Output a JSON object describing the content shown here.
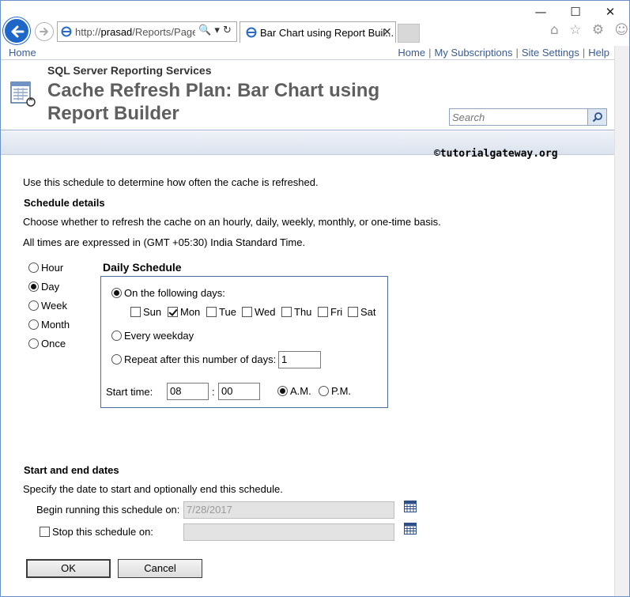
{
  "window": {
    "minimize": "—",
    "maximize": "☐",
    "close": "✕"
  },
  "browser": {
    "address_prefix": "http://",
    "address_host": "prasad",
    "address_path": "/Reports/Page:",
    "address_icons": "🔍 ▾ ↻",
    "tab_title": "Bar Chart using Report Buil...",
    "tab_close": "✕",
    "toolbar_icons": "⌂ ☆ ⚙ ☺"
  },
  "header": {
    "home_left": "Home",
    "links": [
      "Home",
      "My Subscriptions",
      "Site Settings",
      "Help"
    ],
    "ssrs_label": "SQL Server Reporting Services",
    "title": "Cache Refresh Plan: Bar Chart using Report Builder",
    "search_placeholder": "Search",
    "watermark": "©tutorialgateway.org"
  },
  "content": {
    "intro": "Use this schedule to determine how often the cache is refreshed.",
    "schedule_details_heading": "Schedule details",
    "choose_text": "Choose whether to refresh the cache on an hourly, daily, weekly, monthly, or one-time basis.",
    "timezone_text": "All times are expressed in (GMT +05:30) India Standard Time.",
    "frequency_options": [
      {
        "label": "Hour",
        "selected": false
      },
      {
        "label": "Day",
        "selected": true
      },
      {
        "label": "Week",
        "selected": false
      },
      {
        "label": "Month",
        "selected": false
      },
      {
        "label": "Once",
        "selected": false
      }
    ],
    "daily_schedule_heading": "Daily Schedule",
    "following_days_label": "On the following days:",
    "days": [
      {
        "label": "Sun",
        "checked": false
      },
      {
        "label": "Mon",
        "checked": true
      },
      {
        "label": "Tue",
        "checked": false
      },
      {
        "label": "Wed",
        "checked": false
      },
      {
        "label": "Thu",
        "checked": false
      },
      {
        "label": "Fri",
        "checked": false
      },
      {
        "label": "Sat",
        "checked": false
      }
    ],
    "every_weekday_label": "Every weekday",
    "repeat_label": "Repeat after this number of days:",
    "repeat_value": "1",
    "start_time_label": "Start time:",
    "start_hour": "08",
    "time_separator": ":",
    "start_minute": "00",
    "am_label": "A.M.",
    "pm_label": "P.M.",
    "start_end_heading": "Start and end dates",
    "start_end_desc": "Specify the date to start and optionally end this schedule.",
    "begin_label": "Begin running this schedule on:",
    "begin_value": "7/28/2017",
    "stop_label": "Stop this schedule on:",
    "stop_value": "",
    "ok_label": "OK",
    "cancel_label": "Cancel"
  }
}
